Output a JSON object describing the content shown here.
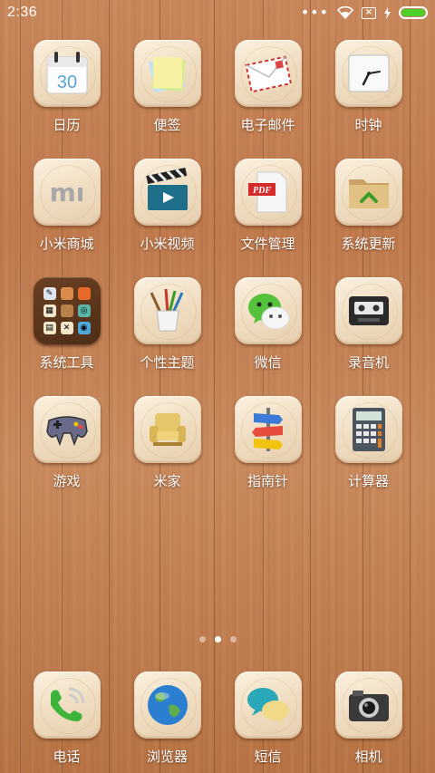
{
  "status": {
    "time": "2:36",
    "more": "•••",
    "sim": "×",
    "battery_level": 1.0,
    "battery_color": "#4fcf2c"
  },
  "apps": [
    {
      "label": "日历",
      "icon": "calendar-icon",
      "day": "30"
    },
    {
      "label": "便签",
      "icon": "notes-icon"
    },
    {
      "label": "电子邮件",
      "icon": "mail-icon"
    },
    {
      "label": "时钟",
      "icon": "clock-icon"
    },
    {
      "label": "小米商城",
      "icon": "mi-store-icon",
      "mark": "mı"
    },
    {
      "label": "小米视频",
      "icon": "video-clapper-icon"
    },
    {
      "label": "文件管理",
      "icon": "pdf-file-icon",
      "mark": "PDF"
    },
    {
      "label": "系统更新",
      "icon": "folder-update-icon"
    },
    {
      "label": "系统工具",
      "icon": "system-tools-folder"
    },
    {
      "label": "个性主题",
      "icon": "paintbrush-cup-icon"
    },
    {
      "label": "微信",
      "icon": "wechat-icon"
    },
    {
      "label": "录音机",
      "icon": "cassette-recorder-icon"
    },
    {
      "label": "游戏",
      "icon": "gamepad-icon"
    },
    {
      "label": "米家",
      "icon": "armchair-icon"
    },
    {
      "label": "指南针",
      "icon": "signpost-compass-icon"
    },
    {
      "label": "计算器",
      "icon": "calculator-icon"
    }
  ],
  "pages": {
    "count": 3,
    "active": 2
  },
  "dock": [
    {
      "label": "电话",
      "icon": "phone-icon"
    },
    {
      "label": "浏览器",
      "icon": "globe-browser-icon"
    },
    {
      "label": "短信",
      "icon": "messages-bubbles-icon"
    },
    {
      "label": "相机",
      "icon": "camera-icon"
    }
  ]
}
